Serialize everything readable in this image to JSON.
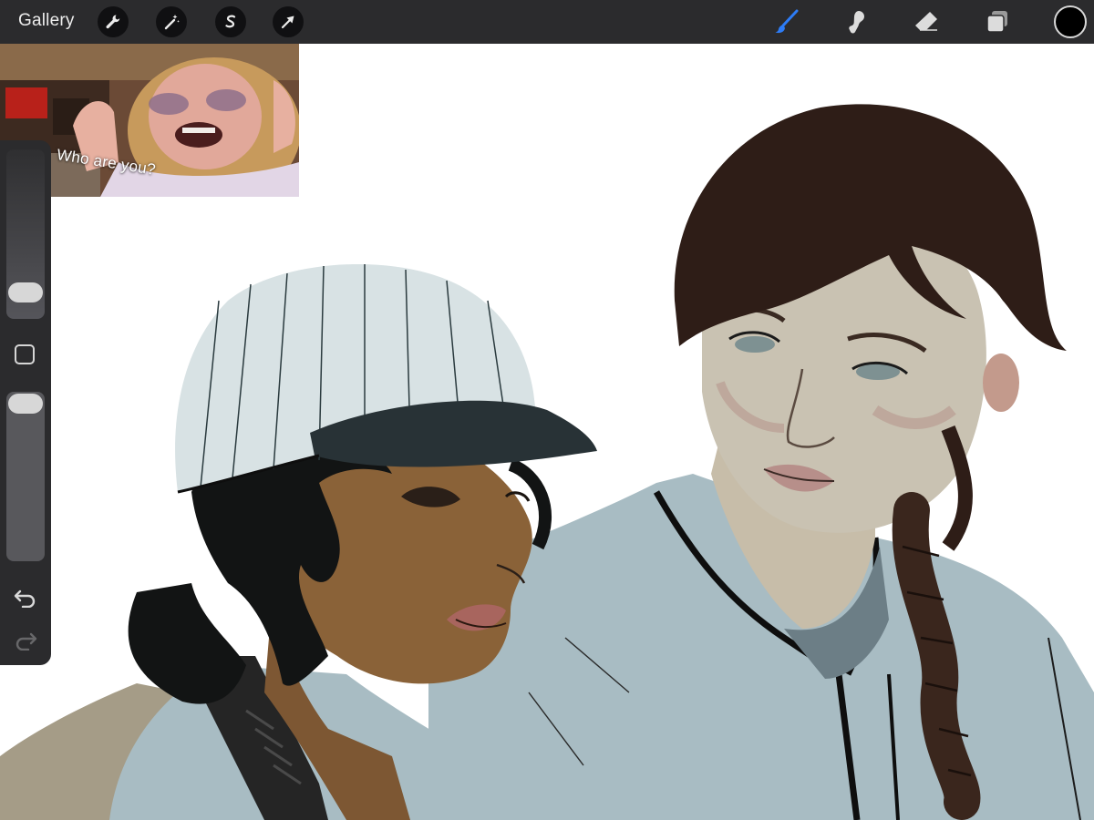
{
  "toolbar": {
    "gallery_label": "Gallery",
    "left_tools": [
      "wrench-icon",
      "magic-wand-icon",
      "selection-icon",
      "transform-arrow-icon"
    ],
    "right_tools": [
      "brush-icon",
      "smudge-icon",
      "eraser-icon",
      "layers-icon"
    ],
    "active_tool": "brush-icon",
    "active_color": "#000000",
    "accent_color": "#2d7cf6"
  },
  "reference": {
    "caption": "Who are you?"
  },
  "sidebar": {
    "brush_size_level": 0.1,
    "opacity_level": 1.0,
    "icons": [
      "modify-square-icon",
      "undo-icon",
      "redo-icon"
    ]
  },
  "colors": {
    "toolbar_bg": "#2b2b2d",
    "jersey": "#a8bcc3",
    "cap": "#d8e2e4",
    "skin_dark": "#8a6238",
    "skin_light": "#c9c2b2",
    "hair_dark": "#121414",
    "hair_brown": "#2e1d17"
  }
}
